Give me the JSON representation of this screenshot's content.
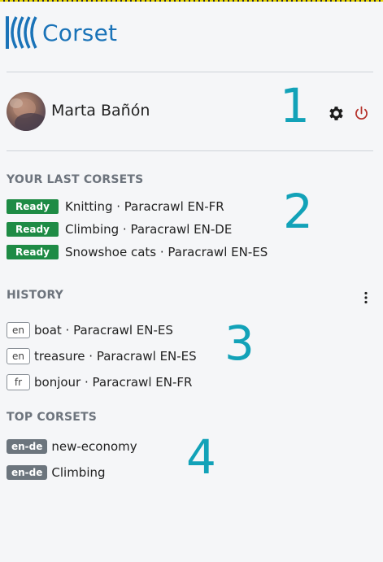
{
  "app": {
    "name": "Corset",
    "brand_color": "#1a73b8"
  },
  "user": {
    "name": "Marta Bañón"
  },
  "annotations": [
    "1",
    "2",
    "3",
    "4"
  ],
  "last_corsets": {
    "title": "YOUR LAST CORSETS",
    "items": [
      {
        "status": "Ready",
        "label": "Knitting · Paracrawl EN-FR"
      },
      {
        "status": "Ready",
        "label": "Climbing · Paracrawl EN-DE"
      },
      {
        "status": "Ready",
        "label": "Snowshoe cats · Paracrawl EN-ES"
      }
    ]
  },
  "history": {
    "title": "HISTORY",
    "items": [
      {
        "lang": "en",
        "label": "boat · Paracrawl EN-ES"
      },
      {
        "lang": "en",
        "label": "treasure · Paracrawl EN-ES"
      },
      {
        "lang": "fr",
        "label": "bonjour · Paracrawl EN-FR"
      }
    ]
  },
  "top_corsets": {
    "title": "TOP CORSETS",
    "items": [
      {
        "pair": "en-de",
        "label": "new-economy"
      },
      {
        "pair": "en-de",
        "label": "Climbing"
      }
    ]
  },
  "colors": {
    "ready_badge": "#1e8b45",
    "pair_badge": "#6c757d",
    "annotation": "#12a2b8",
    "power_icon": "#b5322b"
  }
}
